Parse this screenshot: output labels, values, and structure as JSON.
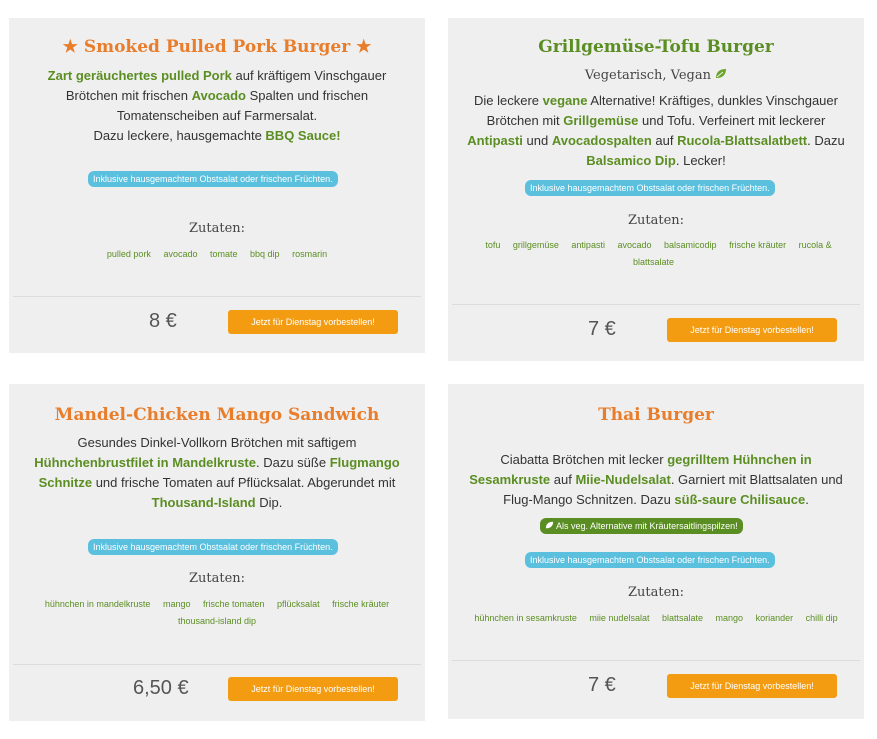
{
  "cards": [
    {
      "title": "Smoked Pulled Pork Burger",
      "desc": {
        "p1": "Zart geräuchertes pulled Pork",
        "t1": " auf kräftigem Vinschgauer Brötchen mit frischen ",
        "p2": "Avocado",
        "t2": " Spalten und frischen Tomatenscheiben auf Farmersalat.",
        "t3": "Dazu leckere, hausgemachte ",
        "p3": "BBQ Sauce!"
      },
      "badge": "Inklusive hausgemachtem Obstsalat oder frischen Früchten.",
      "ingredients_label": "Zutaten:",
      "ingredients": [
        "pulled pork",
        "avocado",
        "tomate",
        "bbq dip",
        "rosmarin"
      ],
      "price": "8 €",
      "order_label": "Jetzt für Dienstag vorbestellen!"
    },
    {
      "title": "Grillgemüse-Tofu Burger",
      "subtitle": "Vegetarisch, Vegan",
      "desc": {
        "t1": "Die leckere ",
        "p1": "vegane",
        "t2": " Alternative! Kräftiges, dunkles Vinschgauer Brötchen mit ",
        "p2": "Grillgemüse",
        "t3": " und Tofu. Verfeinert mit leckerer ",
        "p3": "Antipasti",
        "t4": " und ",
        "p4": "Avocadospalten",
        "t5": " auf ",
        "p5": "Rucola-Blattsalatbett",
        "t6": ". Dazu ",
        "p6": "Balsamico Dip",
        "t7": ". Lecker!"
      },
      "badge": "Inklusive hausgemachtem Obstsalat oder frischen Früchten.",
      "ingredients_label": "Zutaten:",
      "ingredients": [
        "tofu",
        "grillgemüse",
        "antipasti",
        "avocado",
        "balsamicodip",
        "frische kräuter",
        "rucola & blattsalate"
      ],
      "price": "7 €",
      "order_label": "Jetzt für Dienstag vorbestellen!"
    },
    {
      "title": "Mandel-Chicken Mango Sandwich",
      "desc": {
        "t1": "Gesundes Dinkel-Vollkorn Brötchen mit saftigem ",
        "p1": "Hühnchenbrustfilet in Mandelkruste",
        "t2": ". Dazu süße ",
        "p2": "Flugmango Schnitze",
        "t3": " und frische Tomaten auf Pflücksalat. Abgerundet mit ",
        "p3": "Thousand-Island",
        "t4": " Dip."
      },
      "badge": "Inklusive hausgemachtem Obstsalat oder frischen Früchten.",
      "ingredients_label": "Zutaten:",
      "ingredients": [
        "hühnchen in mandelkruste",
        "mango",
        "frische tomaten",
        "pflücksalat",
        "frische kräuter",
        "thousand-island dip"
      ],
      "price": "6,50 €",
      "order_label": "Jetzt für Dienstag vorbestellen!"
    },
    {
      "title": "Thai Burger",
      "desc": {
        "t1": "Ciabatta Brötchen mit lecker ",
        "p1": "gegrilltem Hühnchen in Sesamkruste",
        "t2": " auf ",
        "p2": "Miie-Nudelsalat",
        "t3": ". Garniert mit Blattsalaten und Flug-Mango Schnitzen. Dazu ",
        "p3": "süß-saure Chilisauce",
        "t4": "."
      },
      "veg_badge": "Als veg. Alternative mit Kräutersaitlingspilzen!",
      "badge": "Inklusive hausgemachtem Obstsalat oder frischen Früchten.",
      "ingredients_label": "Zutaten:",
      "ingredients": [
        "hühnchen in sesamkruste",
        "miie nudelsalat",
        "blattsalate",
        "mango",
        "koriander",
        "chilli dip"
      ],
      "price": "7 €",
      "order_label": "Jetzt für Dienstag vorbestellen!"
    }
  ],
  "icons": {
    "star": "star-icon",
    "leaf": "leaf-icon"
  },
  "colors": {
    "orange": "#e87d2b",
    "green": "#5b8e22",
    "badge_blue": "#5bc0de",
    "button": "#f39c12"
  }
}
